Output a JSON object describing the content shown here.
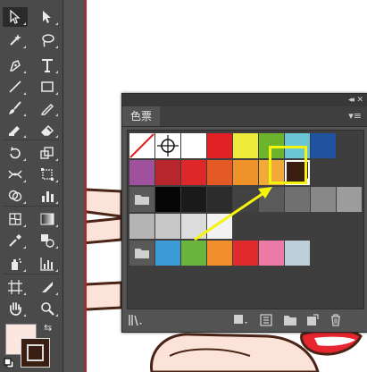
{
  "swatches_panel": {
    "tab_label": "色票",
    "collapse_icon": "double-chevron-left",
    "close_icon": "close",
    "menu_icon": "panel-menu",
    "none_swatch_color": "#ffffff",
    "registration_swatch_color": "#ffffff",
    "row1_colors": [
      "#ffffff",
      "#e22126",
      "#eeea39",
      "#6cb42e",
      "#6bc6d3",
      "#2052a2"
    ],
    "row2_colors": [
      "#a0519d",
      "#b8262d",
      "#dd2728",
      "#e45a27",
      "#ef922a",
      "#f1a93a"
    ],
    "selected_color": "#3b1e12",
    "grays_group1": [
      "#060606",
      "#1a1a1a",
      "#2c2c2c",
      "#424242",
      "#5a5a5a",
      "#707070",
      "#888888",
      "#9c9c9c",
      "#b4b4b4",
      "#c8c8c8",
      "#dcdcdc",
      "#f2f2f2"
    ],
    "group2_colors": [
      "#3c9bd6",
      "#6ab53e",
      "#ef8e2a",
      "#e02a2e",
      "#ec7aa6",
      "#bdd0da"
    ],
    "footer_icons": [
      "swatch-libraries-menu",
      "show-swatch-kinds",
      "swatch-options",
      "new-color-group",
      "new-swatch",
      "delete-swatch"
    ]
  },
  "toolbox": {
    "fill_color": "#fbe7e0",
    "stroke_color": "#3b1e12"
  },
  "annotation": {
    "highlight_color": "#f6f40c"
  }
}
